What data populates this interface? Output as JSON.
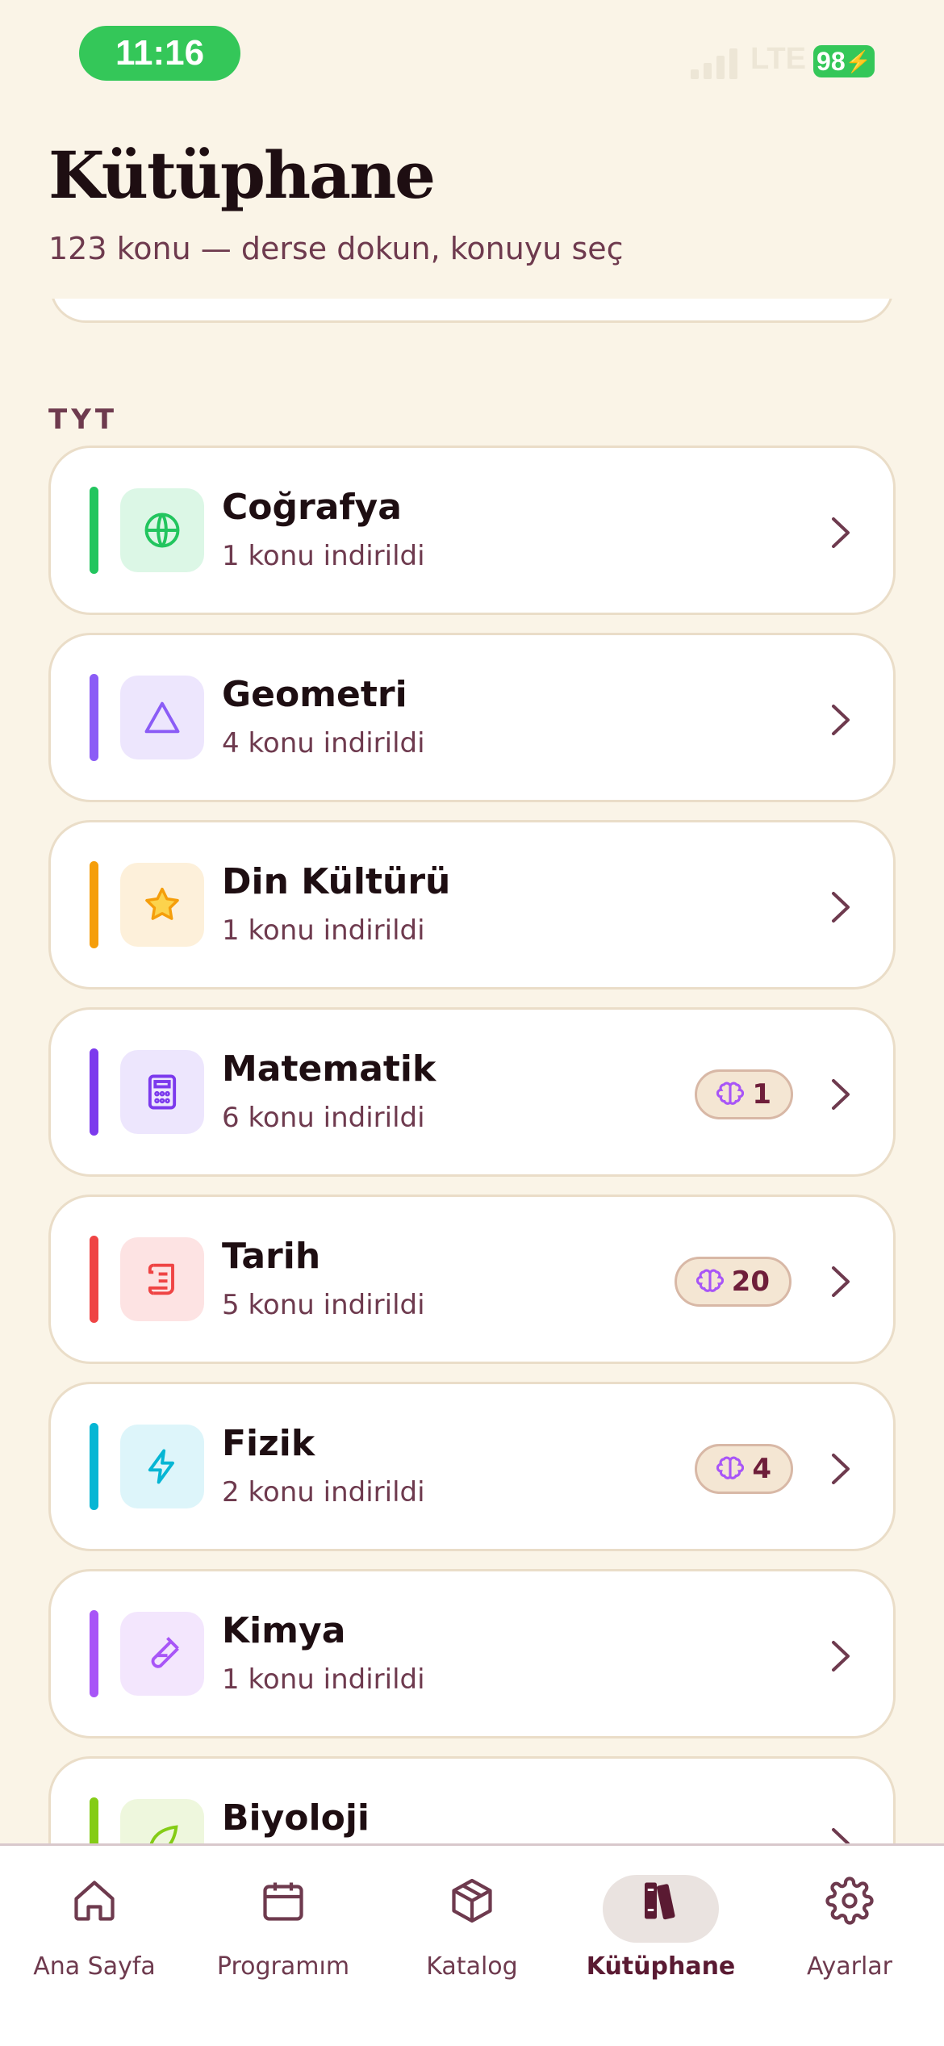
{
  "status": {
    "time": "11:16",
    "network": "LTE",
    "battery": "98"
  },
  "header": {
    "title": "Kütüphane",
    "subtitle": "123 konu — derse dokun, konuyu seç"
  },
  "section": {
    "label": "TYT"
  },
  "subjects": [
    {
      "name": "Coğrafya",
      "sub": "1 konu indirildi",
      "accent": "#22C55E",
      "icon_bg": "#DCF7E6",
      "icon": "globe-icon",
      "badge": null
    },
    {
      "name": "Geometri",
      "sub": "4 konu indirildi",
      "accent": "#8B5CF6",
      "icon_bg": "#EDE6FD",
      "icon": "triangle-icon",
      "badge": null
    },
    {
      "name": "Din Kültürü",
      "sub": "1 konu indirildi",
      "accent": "#F59E0B",
      "icon_bg": "#FDF0DA",
      "icon": "star-icon",
      "badge": null
    },
    {
      "name": "Matematik",
      "sub": "6 konu indirildi",
      "accent": "#7C3AED",
      "icon_bg": "#EDE6FD",
      "icon": "calculator-icon",
      "badge": "1"
    },
    {
      "name": "Tarih",
      "sub": "5 konu indirildi",
      "accent": "#EF4444",
      "icon_bg": "#FDE3E3",
      "icon": "scroll-icon",
      "badge": "20"
    },
    {
      "name": "Fizik",
      "sub": "2 konu indirildi",
      "accent": "#06B6D4",
      "icon_bg": "#DDF5FA",
      "icon": "bolt-icon",
      "badge": "4"
    },
    {
      "name": "Kimya",
      "sub": "1 konu indirildi",
      "accent": "#A855F7",
      "icon_bg": "#F3E6FD",
      "icon": "test-tube-icon",
      "badge": null
    },
    {
      "name": "Biyoloji",
      "sub": "",
      "accent": "#84CC16",
      "icon_bg": "#EEF7DD",
      "icon": "leaf-icon",
      "badge": null
    }
  ],
  "nav": [
    {
      "label": "Ana Sayfa",
      "icon": "home-icon",
      "active": false
    },
    {
      "label": "Programım",
      "icon": "calendar-icon",
      "active": false
    },
    {
      "label": "Katalog",
      "icon": "box-icon",
      "active": false
    },
    {
      "label": "Kütüphane",
      "icon": "books-icon",
      "active": true
    },
    {
      "label": "Ayarlar",
      "icon": "gear-icon",
      "active": false
    }
  ]
}
